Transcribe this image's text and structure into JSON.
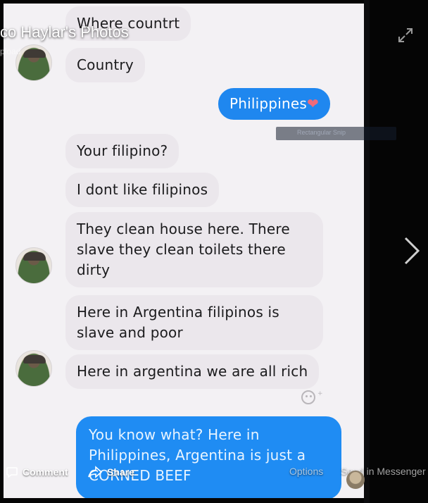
{
  "viewer": {
    "title": "co Haylar's Photos",
    "subtitle": "pload"
  },
  "messages": [
    {
      "id": "m1",
      "direction": "in",
      "text": "Where countrt"
    },
    {
      "id": "m2",
      "direction": "in",
      "text": "Country"
    },
    {
      "id": "m3",
      "direction": "out",
      "text": "Philippines",
      "emoji": "❤"
    },
    {
      "id": "m4",
      "direction": "in",
      "text": "Your filipino?"
    },
    {
      "id": "m5",
      "direction": "in",
      "text": "I dont like filipinos"
    },
    {
      "id": "m6",
      "direction": "in",
      "lines": [
        "They clean house here. There",
        "slave they clean toilets there",
        "dirty"
      ]
    },
    {
      "id": "m7",
      "direction": "in",
      "lines": [
        "Here in Argentina filipinos is",
        "slave and poor"
      ]
    },
    {
      "id": "m8",
      "direction": "in",
      "text": "Here in argentina we are all rich"
    },
    {
      "id": "m9",
      "direction": "out",
      "lines": [
        "You know what? Here in",
        "Philippines, Argentina is just a",
        "CORNED BEEF"
      ]
    }
  ],
  "snip_toolbar": {
    "label": "Rectangular Snip"
  },
  "actions": {
    "comment": "Comment",
    "share": "Share",
    "options": "Options",
    "send": "Send in Messenger"
  },
  "colors": {
    "outgoing_bubble": "#1f87ef",
    "incoming_bubble": "#ebe7ec",
    "viewer_bg": "#050505"
  },
  "icons": [
    "expand-icon",
    "chevron-right-icon",
    "comment-icon",
    "share-icon",
    "emoji-reaction-icon",
    "avatar"
  ]
}
